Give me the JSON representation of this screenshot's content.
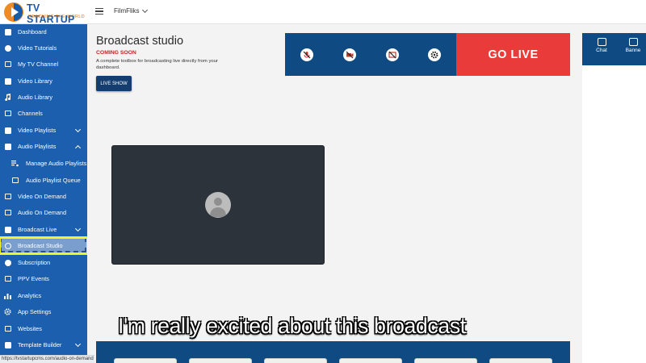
{
  "brand": {
    "name": "TV STARTUP",
    "tagline": "REACHING THE WORLD"
  },
  "header": {
    "channel": "FilmFliks"
  },
  "sidebar": {
    "items": [
      {
        "label": "Dashboard",
        "icon": "dashboard-icon"
      },
      {
        "label": "Video Tutorials",
        "icon": "help-circle-icon"
      },
      {
        "label": "My TV Channel",
        "icon": "tv-icon"
      },
      {
        "label": "Video Library",
        "icon": "video-library-icon"
      },
      {
        "label": "Audio Library",
        "icon": "music-note-icon"
      },
      {
        "label": "Channels",
        "icon": "channels-icon"
      },
      {
        "label": "Video Playlists",
        "icon": "playlist-icon",
        "expand": "down"
      },
      {
        "label": "Audio Playlists",
        "icon": "audio-playlist-icon",
        "expand": "up"
      },
      {
        "label": "Manage Audio Playlists",
        "icon": "queue-music-icon",
        "sub": true
      },
      {
        "label": "Audio Playlist Queue",
        "icon": "queue-play-icon",
        "sub": true
      },
      {
        "label": "Video On Demand",
        "icon": "video-on-demand-icon"
      },
      {
        "label": "Audio On Demand",
        "icon": "audio-on-demand-icon"
      },
      {
        "label": "Broadcast Live",
        "icon": "live-tv-icon",
        "expand": "down"
      },
      {
        "label": "Broadcast Studio",
        "icon": "broadcast-studio-icon",
        "sub": true,
        "active": true
      },
      {
        "label": "Subscription",
        "icon": "dollar-icon"
      },
      {
        "label": "PPV Events",
        "icon": "ticket-icon"
      },
      {
        "label": "Analytics",
        "icon": "analytics-icon"
      },
      {
        "label": "App Settings",
        "icon": "gear-icon"
      },
      {
        "label": "Websites",
        "icon": "website-icon"
      },
      {
        "label": "Template Builder",
        "icon": "template-icon",
        "expand": "down"
      }
    ]
  },
  "main": {
    "title": "Broadcast studio",
    "status": "COMING SOON",
    "description": "A complete toolbox for broadcasting live directly from your dashboard.",
    "live_show_button": "LIVE SHOW",
    "go_live_button": "GO LIVE"
  },
  "controls": [
    {
      "name": "mic-off-icon"
    },
    {
      "name": "camera-off-icon"
    },
    {
      "name": "screen-share-off-icon"
    },
    {
      "name": "gear-icon"
    }
  ],
  "right_panel": {
    "tabs": [
      {
        "label": "Chat",
        "icon": "chat-icon"
      },
      {
        "label": "Banne",
        "icon": "banner-icon"
      }
    ]
  },
  "caption": "I'm really excited about this broadcast",
  "status_url": "https://tvstartupcms.com/audio-on-demand",
  "colors": {
    "sidebar": "#1b5fae",
    "accent_dark": "#0f4b82",
    "go_live": "#ea3b3b",
    "coming_soon": "#cc2222",
    "highlight": "#f4f22a"
  }
}
